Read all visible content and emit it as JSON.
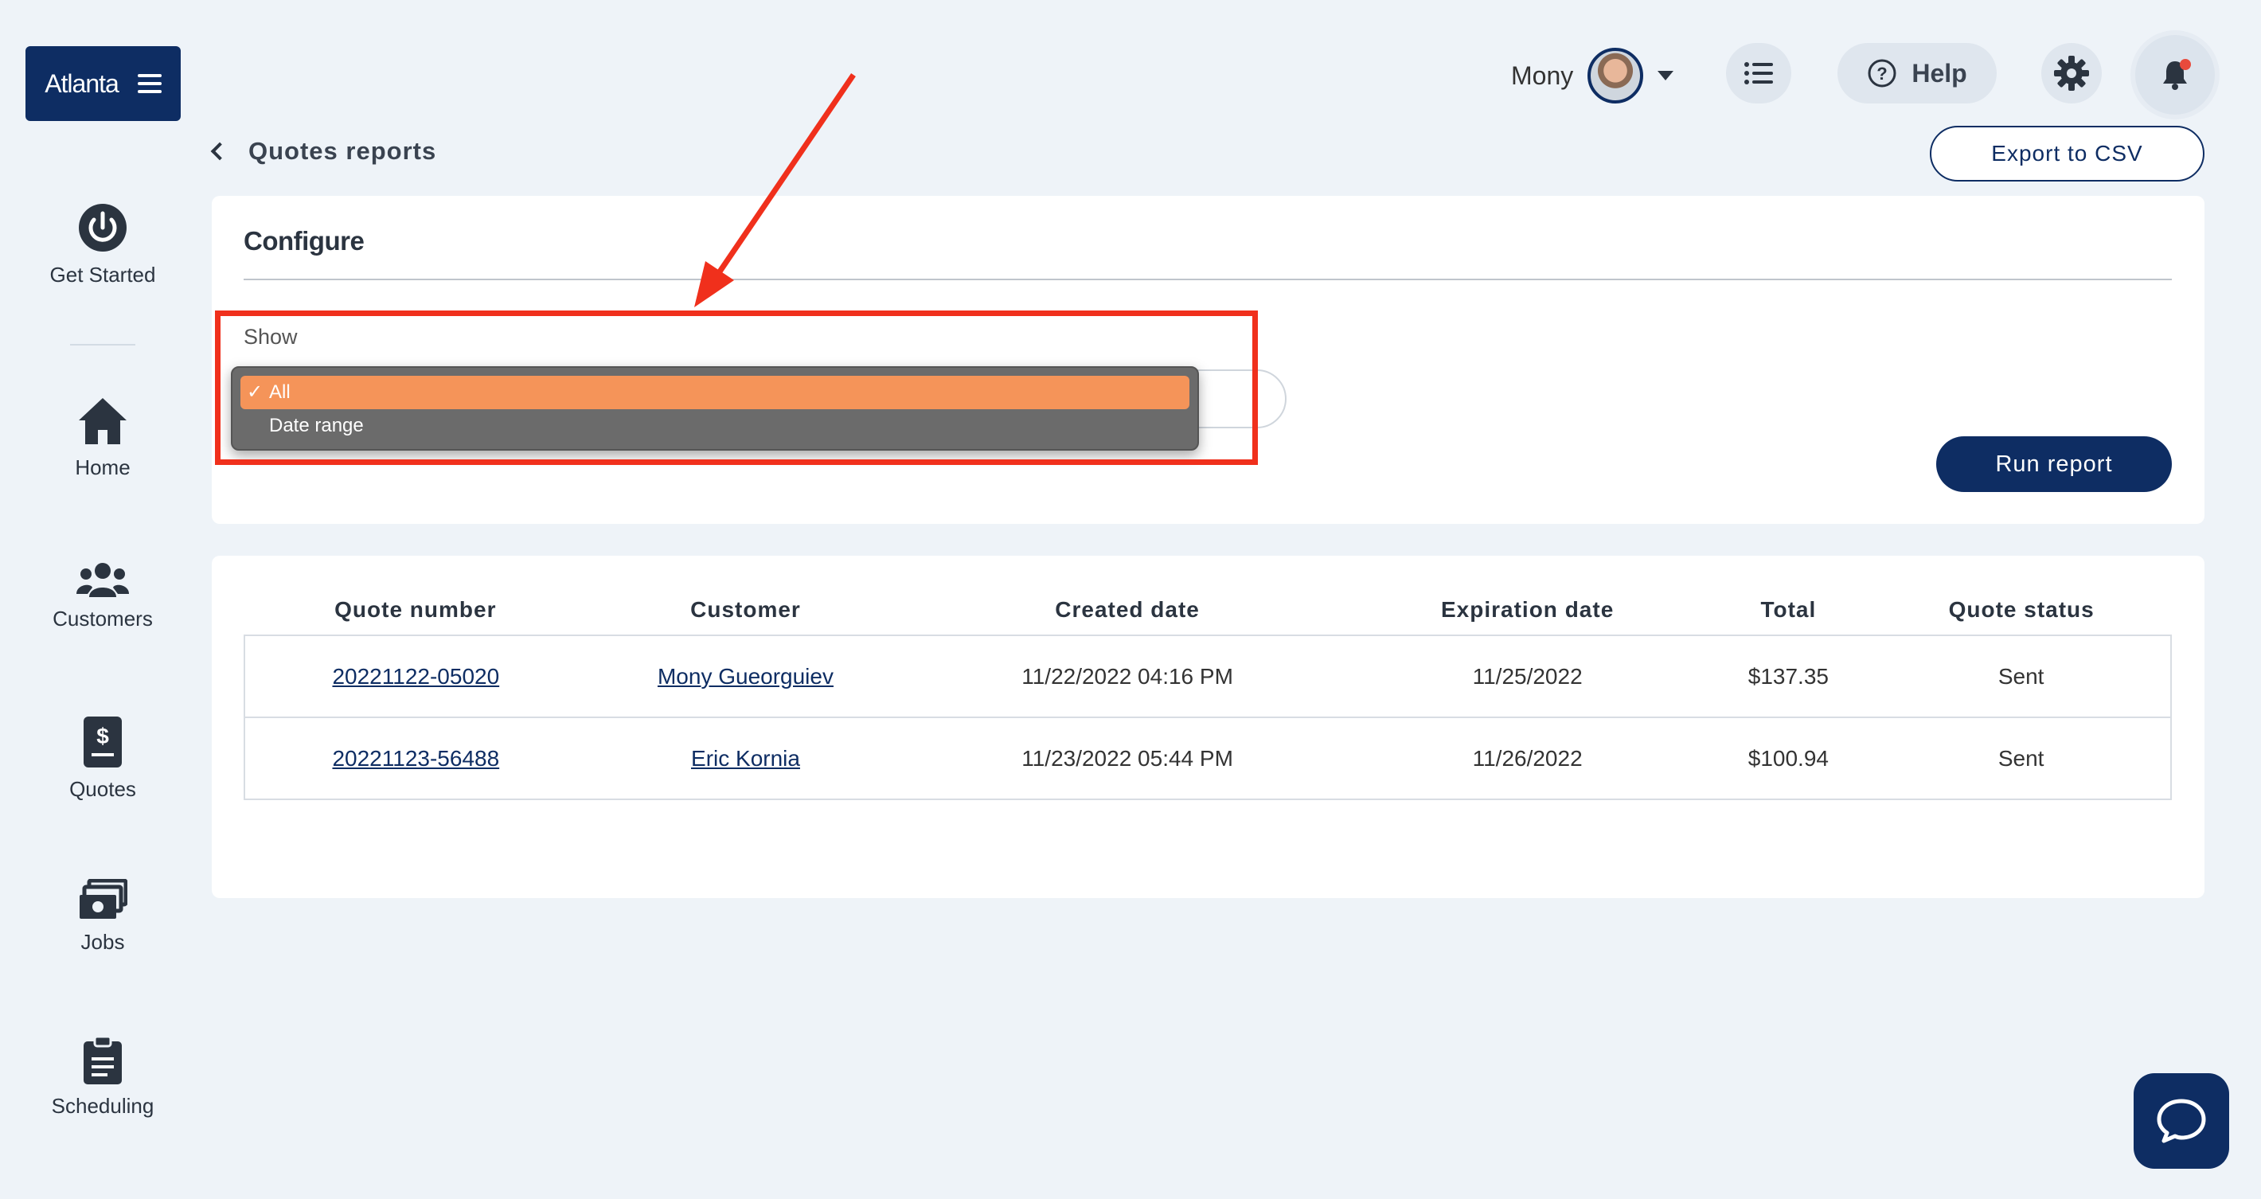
{
  "brand": {
    "name": "Atlanta"
  },
  "sidebar": {
    "items": [
      {
        "label": "Get Started",
        "icon": "power-icon"
      },
      {
        "label": "Home",
        "icon": "home-icon"
      },
      {
        "label": "Customers",
        "icon": "users-icon"
      },
      {
        "label": "Quotes",
        "icon": "quote-icon"
      },
      {
        "label": "Jobs",
        "icon": "cash-icon"
      },
      {
        "label": "Scheduling",
        "icon": "clipboard-icon"
      }
    ]
  },
  "header": {
    "user_name": "Mony",
    "help_label": "Help"
  },
  "page": {
    "title": "Quotes reports",
    "export_label": "Export to CSV"
  },
  "configure": {
    "title": "Configure",
    "show_label": "Show",
    "options": [
      {
        "label": "All",
        "selected": true
      },
      {
        "label": "Date range",
        "selected": false
      }
    ],
    "run_label": "Run report",
    "check_glyph": "✓"
  },
  "table": {
    "columns": [
      "Quote number",
      "Customer",
      "Created date",
      "Expiration date",
      "Total",
      "Quote status"
    ],
    "rows": [
      [
        "20221122-05020",
        "Mony Gueorguiev",
        "11/22/2022 04:16 PM",
        "11/25/2022",
        "$137.35",
        "Sent"
      ],
      [
        "20221123-56488",
        "Eric Kornia",
        "11/23/2022 05:44 PM",
        "11/26/2022",
        "$100.94",
        "Sent"
      ]
    ]
  },
  "colors": {
    "primary": "#0e2d63",
    "background": "#eef3f8",
    "selected_option": "#f59459",
    "annotation": "#f0301c"
  }
}
